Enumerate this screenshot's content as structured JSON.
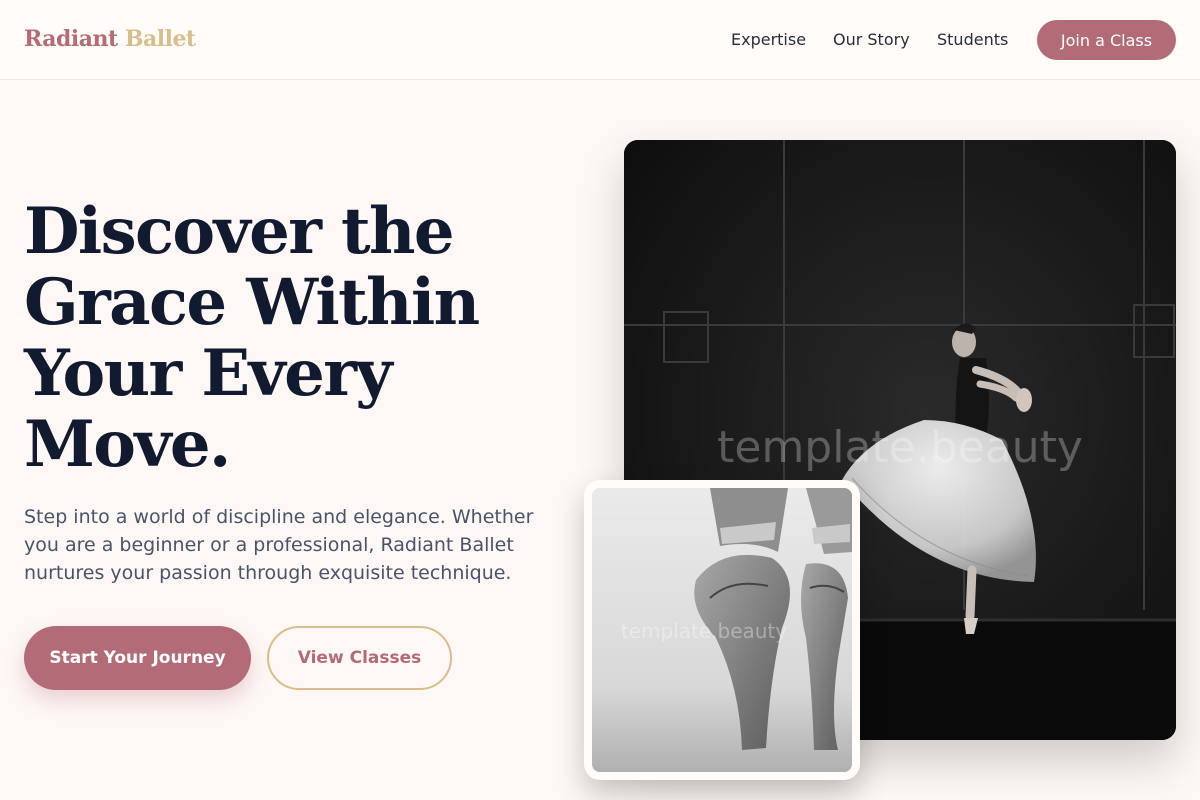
{
  "header": {
    "brand_first": "Radiant",
    "brand_second": "Ballet",
    "nav": [
      {
        "label": "Expertise"
      },
      {
        "label": "Our Story"
      },
      {
        "label": "Students"
      }
    ],
    "cta_label": "Join a Class"
  },
  "hero": {
    "headline_lines": [
      "Discover the",
      "Grace Within",
      "Your Every",
      "Move."
    ],
    "lede": "Step into a world of discipline and elegance. Whether you are a beginner or a professional, Radiant Ballet nurtures your passion through exquisite technique.",
    "primary_button": "Start Your Journey",
    "secondary_button": "View Classes",
    "main_watermark": "template.beauty",
    "inset_watermark": "template.beauty"
  },
  "colors": {
    "accent": "#b46b78",
    "gold": "#d8be8c",
    "heading": "#111a2e",
    "body_text": "#4a5468",
    "background": "#fdf8f5"
  }
}
